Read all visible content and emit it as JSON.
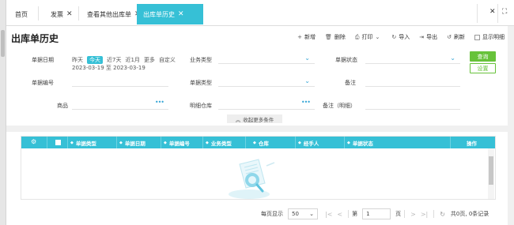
{
  "tabs": [
    {
      "label": "首页",
      "closable": false
    },
    {
      "label": "发票",
      "closable": true
    },
    {
      "label": "查看其他出库单",
      "closable": true
    },
    {
      "label": "出库单历史",
      "closable": true,
      "active": true
    }
  ],
  "tab_controls": {
    "close": "✕",
    "fullscreen": "⛶"
  },
  "page_title": "出库单历史",
  "toolbar": {
    "new": "新增",
    "delete": "删除",
    "print": "打印",
    "import": "导入",
    "export": "导出",
    "refresh": "刷新",
    "show_detail": "显示明细"
  },
  "filter": {
    "doc_date_label": "单据日期",
    "date_quick": [
      "昨天",
      "今天",
      "近7天",
      "近1月",
      "更多",
      "自定义"
    ],
    "date_quick_active": "今天",
    "date_range": "2023-03-19 至 2023-03-19",
    "biz_type_label": "业务类型",
    "doc_status_label": "单据状态",
    "doc_no_label": "单据编号",
    "doc_type_label": "单据类型",
    "remark_label": "备注",
    "goods_label": "商品",
    "detail_warehouse_label": "明细仓库",
    "remark_detail_label": "备注（明细）",
    "query_btn": "查询",
    "reset_btn": "设置",
    "collapse": "收起更多条件"
  },
  "grid": {
    "columns": [
      "单据类型",
      "单据日期",
      "单据编号",
      "业务类型",
      "仓库",
      "经手人",
      "单据状态",
      "操作"
    ]
  },
  "pager": {
    "per_page_label": "每页显示",
    "per_page": "50",
    "page_prefix": "第",
    "page_value": "1",
    "page_suffix": "页",
    "summary": "共0页, 0条记录"
  },
  "colors": {
    "accent": "#36c0d6",
    "query_green": "#67c23a"
  }
}
